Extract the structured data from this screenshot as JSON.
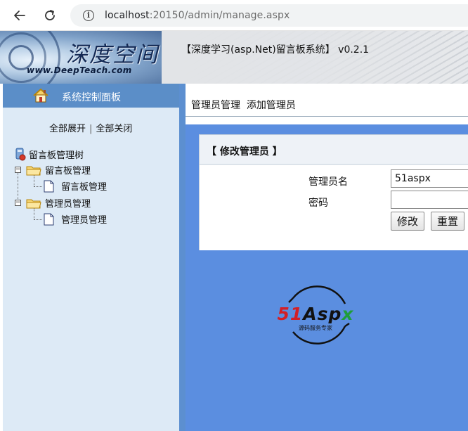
{
  "browser": {
    "url_host": "localhost",
    "url_rest": ":20150/admin/manage.aspx"
  },
  "banner": {
    "logo_title": "深度空间",
    "logo_url": "www.DeepTeach.com",
    "title": "【深度学习(asp.Net)留言板系统】 v0.2.1"
  },
  "sidebar": {
    "header": "系统控制面板",
    "expand_all": "全部展开",
    "separator": "|",
    "collapse_all": "全部关闭",
    "tree_root": "留言板管理树",
    "groups": [
      {
        "label": "留言板管理",
        "children": [
          "留言板管理"
        ]
      },
      {
        "label": "管理员管理",
        "children": [
          "管理员管理"
        ]
      }
    ]
  },
  "main": {
    "top_links": [
      "管理员管理",
      "添加管理员"
    ],
    "form_title": "【 修改管理员 】",
    "username_label": "管理员名",
    "username_value": "51aspx",
    "password_label": "密码",
    "password_value": "",
    "modify_button": "修改",
    "reset_button": "重置",
    "watermark_main": "51Aspx",
    "watermark_sub": "源码服务专家"
  },
  "colors": {
    "sidebar_header": "#5b8ec8",
    "sidebar_bg": "#ddeaf6",
    "main_bg": "#5b8ee0"
  }
}
